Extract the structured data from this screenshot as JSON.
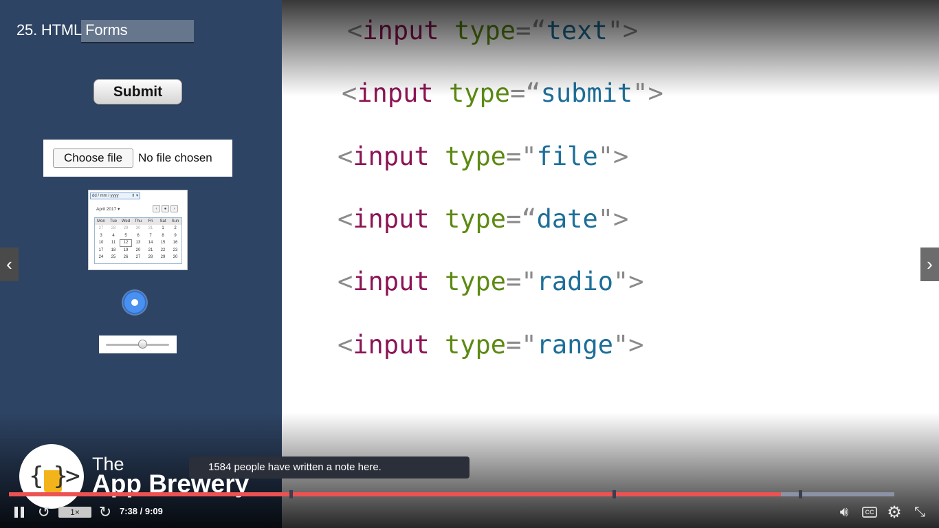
{
  "lecture": {
    "title": "25. HTML Forms"
  },
  "demo": {
    "submit_label": "Submit",
    "file": {
      "choose_label": "Choose file",
      "status": "No file chosen"
    },
    "date_picker": {
      "input_placeholder": "dd / mm / yyyy",
      "month_label": "April 2017 ▾",
      "nav": [
        "‹",
        "●",
        "›"
      ],
      "weekdays": [
        "Mon",
        "Tue",
        "Wed",
        "Thu",
        "Fri",
        "Sat",
        "Sun"
      ],
      "weeks": [
        [
          "27",
          "28",
          "29",
          "30",
          "31",
          "1",
          "2"
        ],
        [
          "3",
          "4",
          "5",
          "6",
          "7",
          "8",
          "9"
        ],
        [
          "10",
          "11",
          "12",
          "13",
          "14",
          "15",
          "16"
        ],
        [
          "17",
          "18",
          "19",
          "20",
          "21",
          "22",
          "23"
        ],
        [
          "24",
          "25",
          "26",
          "27",
          "28",
          "29",
          "30"
        ]
      ],
      "selected_day": "12"
    },
    "radio_checked": true,
    "range_value_fraction": 0.58
  },
  "code_lines": [
    {
      "open": "<",
      "tag": "input",
      "attr": "type",
      "eq": "=",
      "q1": "“",
      "value": "text",
      "q2": "\"",
      "close": ">"
    },
    {
      "open": "<",
      "tag": "input",
      "attr": "type",
      "eq": "=",
      "q1": "“",
      "value": "submit",
      "q2": "\"",
      "close": ">"
    },
    {
      "open": "<",
      "tag": "input",
      "attr": "type",
      "eq": "=",
      "q1": "\"",
      "value": "file",
      "q2": "\"",
      "close": ">"
    },
    {
      "open": "<",
      "tag": "input",
      "attr": "type",
      "eq": "=",
      "q1": "“",
      "value": "date",
      "q2": "\"",
      "close": ">"
    },
    {
      "open": "<",
      "tag": "input",
      "attr": "type",
      "eq": "=",
      "q1": "\"",
      "value": "radio",
      "q2": "\"",
      "close": ">"
    },
    {
      "open": "<",
      "tag": "input",
      "attr": "type",
      "eq": "=",
      "q1": "\"",
      "value": "range",
      "q2": "\"",
      "close": ">"
    }
  ],
  "brand": {
    "line1": "The",
    "line2": "App Brewery",
    "cup_color": "#f2b41a"
  },
  "note_tooltip": "1584 people have written a note here.",
  "player": {
    "progress_fraction": 0.872,
    "marker_fractions": [
      0.318,
      0.683,
      0.894
    ],
    "speed_label": "1×",
    "time": "7:38 / 9:09",
    "cc_label": "CC",
    "accent_color": "#ec5252"
  },
  "icons": {
    "prev": "chevron-left-icon",
    "next": "chevron-right-icon",
    "pause": "pause-icon",
    "rewind": "rewind-icon",
    "forward": "forward-icon",
    "volume": "volume-icon",
    "settings": "gear-icon",
    "fullscreen": "exit-fullscreen-icon"
  }
}
